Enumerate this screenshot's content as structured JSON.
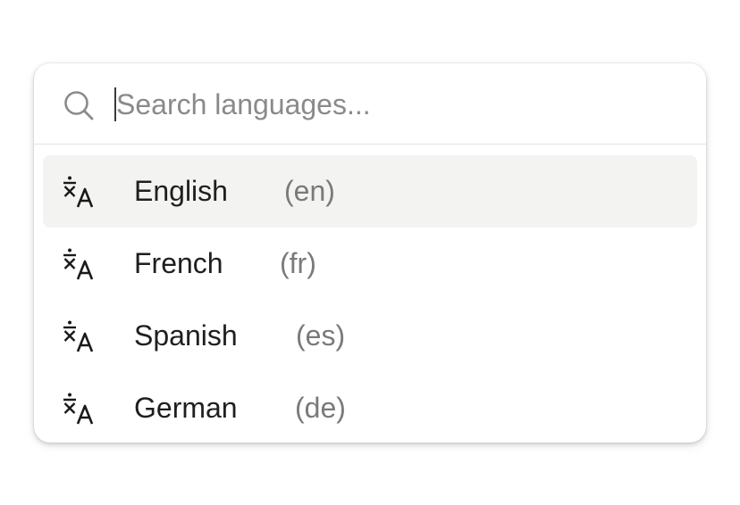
{
  "search": {
    "placeholder": "Search languages...",
    "value": ""
  },
  "languages": [
    {
      "name": "English",
      "code": "(en)",
      "active": true
    },
    {
      "name": "French",
      "code": "(fr)",
      "active": false
    },
    {
      "name": "Spanish",
      "code": "(es)",
      "active": false
    },
    {
      "name": "German",
      "code": "(de)",
      "active": false
    }
  ],
  "icons": {
    "search": "search-icon",
    "language": "translate-icon"
  },
  "colors": {
    "highlight": "#f3f3f2",
    "text": "#1f1f1f",
    "muted": "#7a7a7a",
    "placeholder": "#8a8a8a"
  }
}
